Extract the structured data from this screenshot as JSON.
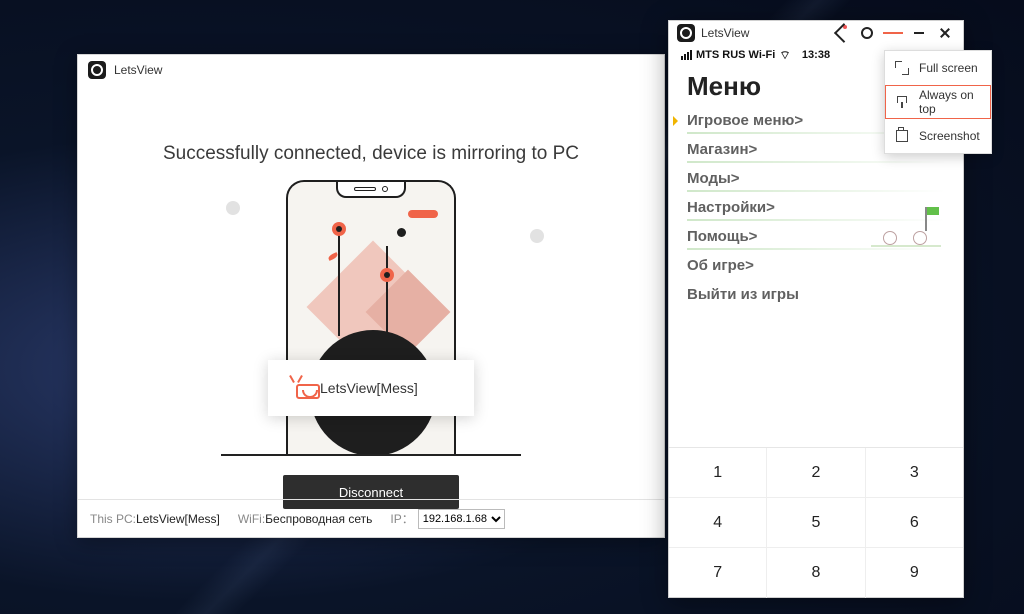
{
  "app_name": "LetsView",
  "main_window": {
    "title": "LetsView",
    "status_text": "Successfully connected, device is mirroring to PC",
    "device_card_name": "LetsView[Mess]",
    "disconnect_label": "Disconnect",
    "statusbar": {
      "pc_label": "This PC:",
      "pc_name": "LetsView[Mess]",
      "wifi_label": "WiFi:",
      "wifi_name": "Беспроводная сеть",
      "ip_label": "IP：",
      "ip_value": "192.168.1.68"
    }
  },
  "mirror_window": {
    "title": "LetsView",
    "phone_status": {
      "carrier": "MTS RUS Wi-Fi",
      "time": "13:38"
    },
    "menu_title": "Меню",
    "menu_items": [
      {
        "label": "Игровое меню>",
        "active": true
      },
      {
        "label": "Магазин>",
        "active": false
      },
      {
        "label": "Моды>",
        "active": false
      },
      {
        "label": "Настройки>",
        "active": false
      },
      {
        "label": "Помощь>",
        "active": false
      },
      {
        "label": "Об игре>",
        "active": false
      },
      {
        "label": "Выйти из игры",
        "active": false
      }
    ],
    "keypad": [
      [
        "1",
        "2",
        "3"
      ],
      [
        "4",
        "5",
        "6"
      ],
      [
        "7",
        "8",
        "9"
      ]
    ]
  },
  "dropdown": {
    "items": [
      {
        "icon": "fullscreen",
        "label": "Full screen",
        "selected": false
      },
      {
        "icon": "pin",
        "label": "Always on top",
        "selected": true
      },
      {
        "icon": "screenshot",
        "label": "Screenshot",
        "selected": false
      }
    ]
  }
}
